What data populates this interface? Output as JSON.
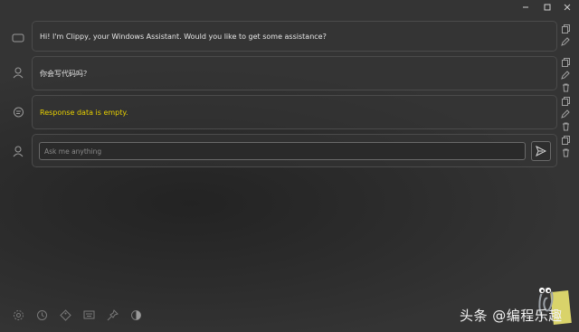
{
  "window": {
    "minimize_icon": "minimize-icon",
    "maximize_icon": "maximize-icon",
    "close_icon": "close-icon"
  },
  "messages": [
    {
      "role": "assistant",
      "avatar_icon": "window-icon",
      "text": "Hi! I'm Clippy, your Windows Assistant. Would you like to get some assistance?",
      "actions": [
        "copy-icon",
        "edit-icon"
      ]
    },
    {
      "role": "user",
      "avatar_icon": "user-icon",
      "text": "你会写代码吗？",
      "actions": [
        "copy-icon",
        "edit-icon",
        "delete-icon"
      ]
    },
    {
      "role": "assistant",
      "avatar_icon": "chat-bubble-icon",
      "text": "Response data is empty.",
      "text_color": "#e8d000",
      "actions": [
        "copy-icon",
        "edit-icon",
        "delete-icon"
      ]
    }
  ],
  "composer": {
    "avatar_icon": "user-icon",
    "placeholder": "Ask me anything",
    "send_icon": "send-icon",
    "actions": [
      "copy-icon",
      "delete-icon"
    ]
  },
  "toolbar": [
    "settings-icon",
    "history-icon",
    "tag-icon",
    "keyboard-icon",
    "pin-icon",
    "contrast-icon"
  ],
  "watermark": {
    "text": "头条 @编程乐趣"
  },
  "colors": {
    "accent_warning": "#e8d000",
    "border": "#4b4b4b",
    "text": "#e6e6e6"
  }
}
